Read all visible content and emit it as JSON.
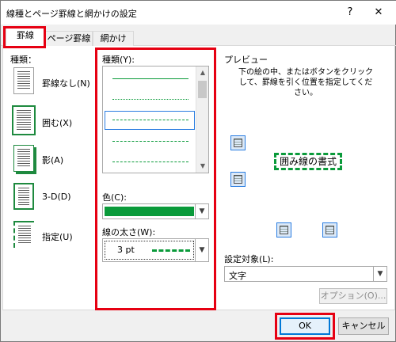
{
  "window": {
    "title": "線種とページ罫線と網かけの設定",
    "help_glyph": "?",
    "close_glyph": "✕"
  },
  "tabs": [
    {
      "label": "罫線",
      "active": true
    },
    {
      "label": "ページ罫線",
      "active": false
    },
    {
      "label": "網かけ",
      "active": false
    }
  ],
  "setting_type": {
    "heading": "種類：",
    "items": [
      {
        "label": "罫線なし(N)",
        "selected": false
      },
      {
        "label": "囲む(X)",
        "selected": true
      },
      {
        "label": "影(A)",
        "selected": false
      },
      {
        "label": "3-D(D)",
        "selected": false
      },
      {
        "label": "指定(U)",
        "selected": false
      }
    ]
  },
  "style": {
    "heading": "種類(Y):",
    "line_samples": [
      "solid",
      "dotted-fine",
      "dashed-small",
      "dashed-medium",
      "dashed-large"
    ],
    "selected_index": 2
  },
  "color": {
    "label": "色(C):",
    "value_color": "#0a9a3a"
  },
  "width": {
    "label": "線の太さ(W):",
    "value": "3 pt"
  },
  "preview": {
    "heading": "プレビュー",
    "instructions": "下の絵の中、またはボタンをクリックして、罫線を引く位置を指定してください。",
    "sample_text": "囲み線の書式",
    "border_color": "#0a9a3a"
  },
  "apply_to": {
    "label": "設定対象(L):",
    "value": "文字"
  },
  "buttons": {
    "options": "オプション(O)...",
    "ok": "OK",
    "cancel": "キャンセル"
  },
  "colors": {
    "highlight": "#e60012",
    "accent": "#0a9a3a",
    "focus": "#0078d7"
  }
}
